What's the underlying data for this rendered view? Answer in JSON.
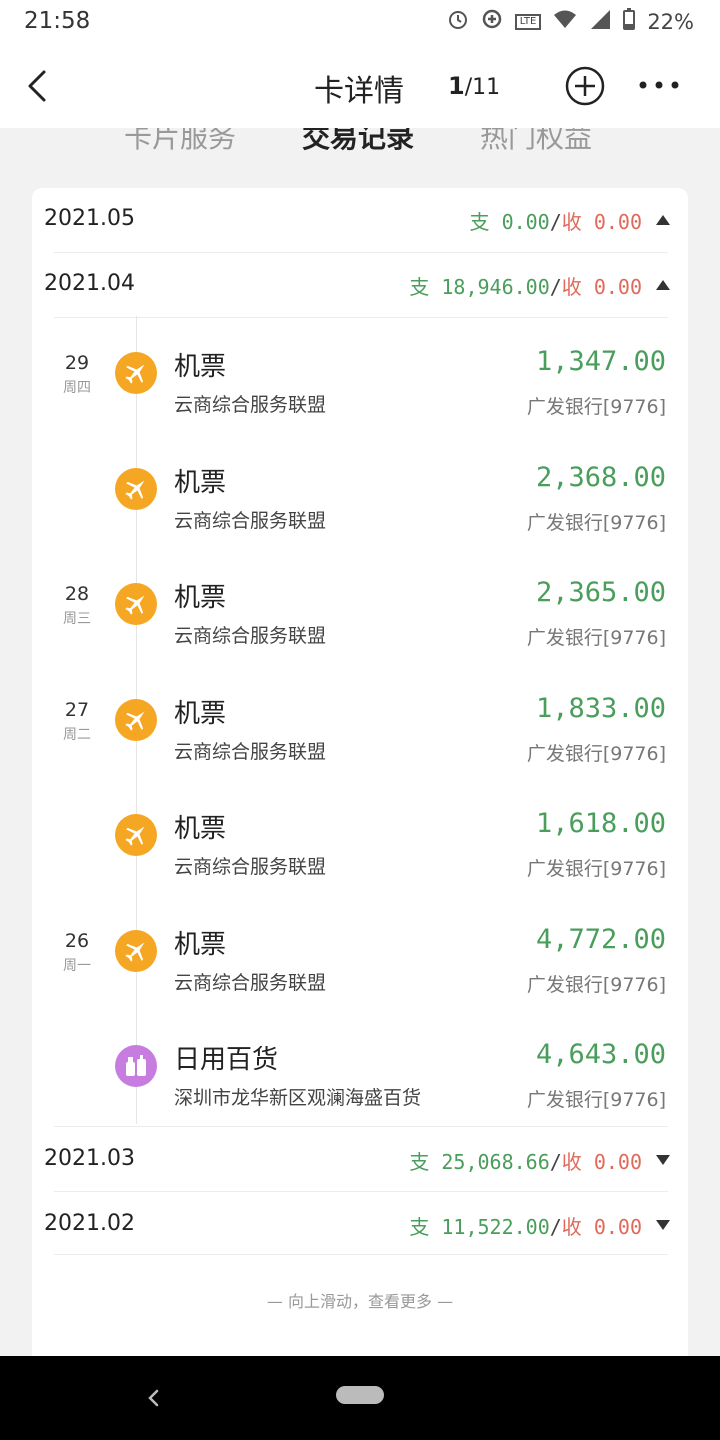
{
  "status_bar": {
    "time": "21:58",
    "battery": "22%",
    "network": "LTE"
  },
  "header": {
    "back_icon": "chevron-left-icon",
    "title": "卡详情",
    "page_current": "1",
    "page_total": "/11",
    "add_icon": "plus-circle-icon",
    "more_icon": "more-dots-icon"
  },
  "tabs": [
    {
      "label": "卡片服务",
      "active": false
    },
    {
      "label": "交易记录",
      "active": true
    },
    {
      "label": "热门权益",
      "active": false
    }
  ],
  "months": [
    {
      "label": "2021.05",
      "out_label": "支",
      "out_value": "0.00",
      "in_label": "收",
      "in_value": "0.00",
      "slash": "/",
      "expanded": true
    },
    {
      "label": "2021.04",
      "out_label": "支",
      "out_value": "18,946.00",
      "in_label": "收",
      "in_value": "0.00",
      "slash": "/",
      "expanded": true
    },
    {
      "label": "2021.03",
      "out_label": "支",
      "out_value": "25,068.66",
      "in_label": "收",
      "in_value": "0.00",
      "slash": "/",
      "expanded": false
    },
    {
      "label": "2021.02",
      "out_label": "支",
      "out_value": "11,522.00",
      "in_label": "收",
      "in_value": "0.00",
      "slash": "/",
      "expanded": false
    }
  ],
  "transactions": [
    {
      "day": "29",
      "weekday": "周四",
      "icon": "airplane-icon",
      "icon_color": "#f5a623",
      "name": "机票",
      "merchant": "云商综合服务联盟",
      "amount": "1,347.00",
      "bank": "广发银行[9776]"
    },
    {
      "day": "",
      "weekday": "",
      "icon": "airplane-icon",
      "icon_color": "#f5a623",
      "name": "机票",
      "merchant": "云商综合服务联盟",
      "amount": "2,368.00",
      "bank": "广发银行[9776]"
    },
    {
      "day": "28",
      "weekday": "周三",
      "icon": "airplane-icon",
      "icon_color": "#f5a623",
      "name": "机票",
      "merchant": "云商综合服务联盟",
      "amount": "2,365.00",
      "bank": "广发银行[9776]"
    },
    {
      "day": "27",
      "weekday": "周二",
      "icon": "airplane-icon",
      "icon_color": "#f5a623",
      "name": "机票",
      "merchant": "云商综合服务联盟",
      "amount": "1,833.00",
      "bank": "广发银行[9776]"
    },
    {
      "day": "",
      "weekday": "",
      "icon": "airplane-icon",
      "icon_color": "#f5a623",
      "name": "机票",
      "merchant": "云商综合服务联盟",
      "amount": "1,618.00",
      "bank": "广发银行[9776]"
    },
    {
      "day": "26",
      "weekday": "周一",
      "icon": "airplane-icon",
      "icon_color": "#f5a623",
      "name": "机票",
      "merchant": "云商综合服务联盟",
      "amount": "4,772.00",
      "bank": "广发银行[9776]"
    },
    {
      "day": "",
      "weekday": "",
      "icon": "bottles-icon",
      "icon_color": "#c77ce0",
      "name": "日用百货",
      "merchant": "深圳市龙华新区观澜海盛百货",
      "amount": "4,643.00",
      "bank": "广发银行[9776]"
    }
  ],
  "footer_hint": "— 向上滑动，查看更多 —",
  "colors": {
    "expense": "#4a9e5c",
    "income": "#e06a5a"
  }
}
